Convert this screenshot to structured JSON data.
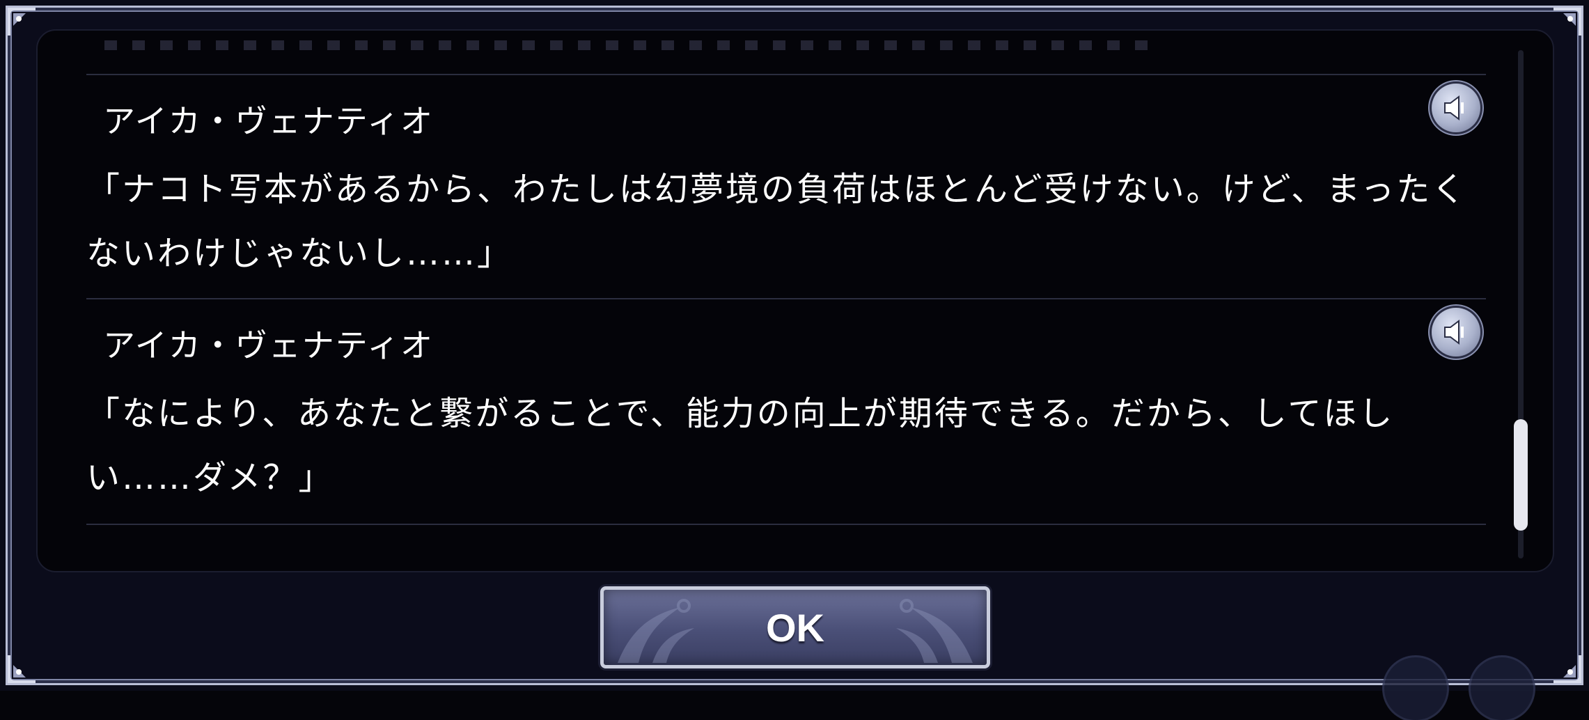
{
  "backlog": {
    "entries": [
      {
        "speaker": "アイカ・ヴェナティオ",
        "text": "「ナコト写本があるから、わたしは幻夢境の負荷はほとんど受けない。けど、まったくないわけじゃないし……」",
        "voice_icon": "speaker-icon"
      },
      {
        "speaker": "アイカ・ヴェナティオ",
        "text": "「なにより、あなたと繋がることで、能力の向上が期待できる。だから、してほしい……ダメ？」",
        "voice_icon": "speaker-icon"
      }
    ]
  },
  "ok_button": {
    "label": "OK"
  },
  "colors": {
    "frame_border": "#b9bed6",
    "panel_background": "#040409",
    "text": "#ffffff",
    "button_fill": "#4a4f77"
  }
}
